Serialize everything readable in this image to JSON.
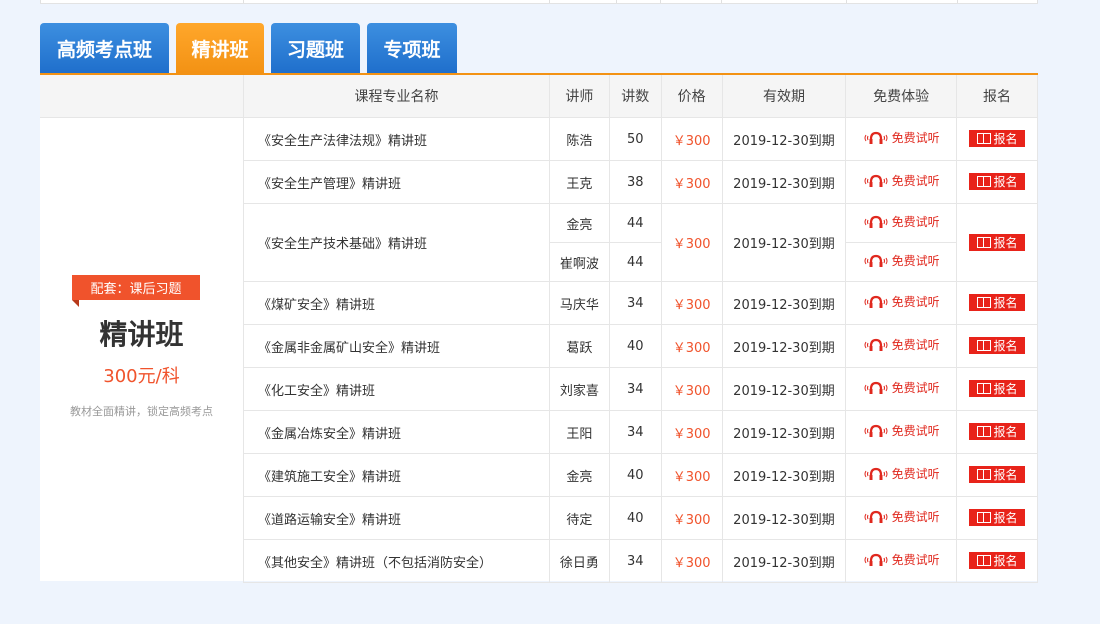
{
  "tabs": [
    {
      "label": "高频考点班",
      "active": false
    },
    {
      "label": "精讲班",
      "active": true
    },
    {
      "label": "习题班",
      "active": false
    },
    {
      "label": "专项班",
      "active": false
    }
  ],
  "summary": {
    "ribbon": "配套：课后习题",
    "title": "精讲班",
    "price": "300元/科",
    "desc": "教材全面精讲，锁定高频考点"
  },
  "columns": [
    "课程专业名称",
    "讲师",
    "讲数",
    "价格",
    "有效期",
    "免费体验",
    "报名"
  ],
  "trial_label": "免费试听",
  "enroll_label": "报名",
  "courses": [
    {
      "name": "《安全生产法律法规》精讲班",
      "teacher": "陈浩",
      "lectures": "50",
      "price": "￥300",
      "valid": "2019-12-30到期"
    },
    {
      "name": "《安全生产管理》精讲班",
      "teacher": "王克",
      "lectures": "38",
      "price": "￥300",
      "valid": "2019-12-30到期"
    },
    {
      "name": "《安全生产技术基础》精讲班",
      "teacher": "金亮",
      "lectures": "44",
      "price": "￥300",
      "valid": "2019-12-30到期",
      "teacher2": "崔啊波",
      "lectures2": "44"
    },
    {
      "name": "《煤矿安全》精讲班",
      "teacher": "马庆华",
      "lectures": "34",
      "price": "￥300",
      "valid": "2019-12-30到期"
    },
    {
      "name": "《金属非金属矿山安全》精讲班",
      "teacher": "葛跃",
      "lectures": "40",
      "price": "￥300",
      "valid": "2019-12-30到期"
    },
    {
      "name": "《化工安全》精讲班",
      "teacher": "刘家喜",
      "lectures": "34",
      "price": "￥300",
      "valid": "2019-12-30到期"
    },
    {
      "name": "《金属冶炼安全》精讲班",
      "teacher": "王阳",
      "lectures": "34",
      "price": "￥300",
      "valid": "2019-12-30到期"
    },
    {
      "name": "《建筑施工安全》精讲班",
      "teacher": "金亮",
      "lectures": "40",
      "price": "￥300",
      "valid": "2019-12-30到期"
    },
    {
      "name": "《道路运输安全》精讲班",
      "teacher": "待定",
      "lectures": "40",
      "price": "￥300",
      "valid": "2019-12-30到期"
    },
    {
      "name": "《其他安全》精讲班（不包括消防安全）",
      "teacher": "徐日勇",
      "lectures": "34",
      "price": "￥300",
      "valid": "2019-12-30到期"
    }
  ],
  "colors": {
    "tab_blue": "#1f6fcc",
    "tab_active": "#f39214",
    "accent_red": "#e8231a",
    "price": "#f0532c"
  },
  "icons": {
    "trial": "headphones-icon",
    "enroll": "book-icon"
  }
}
